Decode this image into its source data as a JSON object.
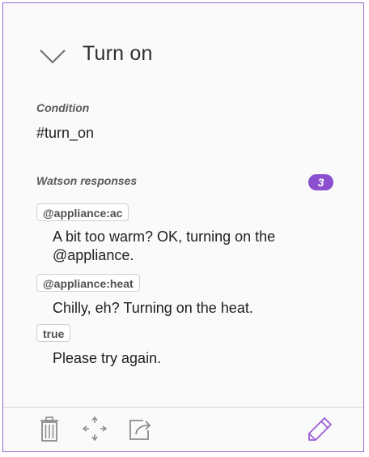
{
  "node": {
    "title": "Turn on",
    "condition_label": "Condition",
    "condition_value": "#turn_on",
    "responses_label": "Watson responses",
    "responses_count": "3",
    "responses": [
      {
        "tag": "@appliance:ac",
        "text": "A bit too warm? OK, turning on the @appliance."
      },
      {
        "tag": "@appliance:heat",
        "text": "Chilly, eh? Turning on the heat."
      },
      {
        "tag": "true",
        "text": "Please try again."
      }
    ]
  },
  "colors": {
    "accent": "#8b4fcf",
    "border": "#9a68d6",
    "icon_gray": "#8c8c8c"
  },
  "icons": [
    "chevron-down-icon",
    "trash-icon",
    "move-icon",
    "export-icon",
    "pencil-icon"
  ]
}
